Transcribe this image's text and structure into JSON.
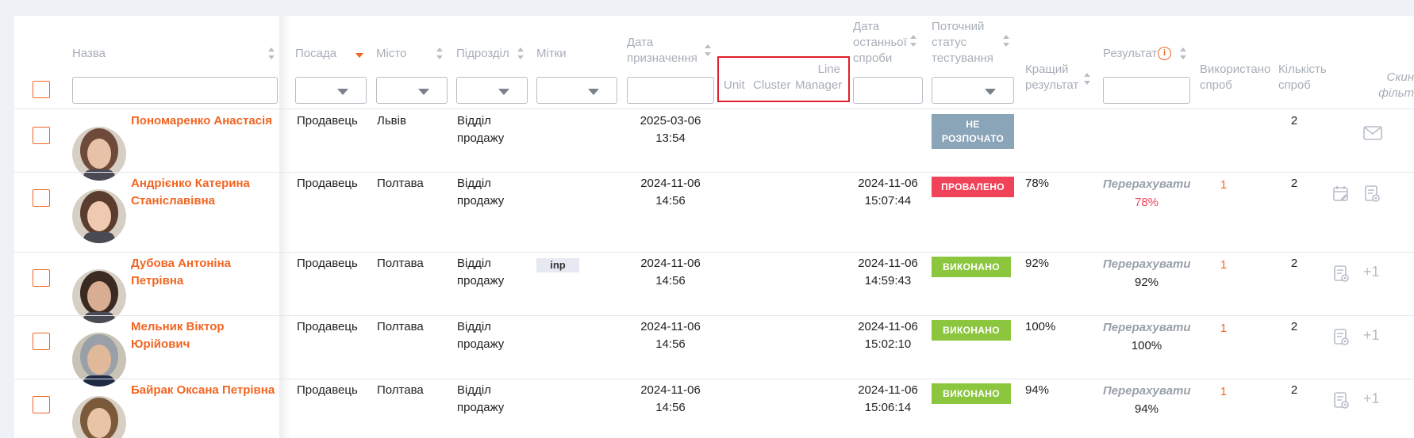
{
  "headers": {
    "name": "Назва",
    "position": "Посада",
    "city": "Місто",
    "department": "Підрозділ",
    "tags": "Мітки",
    "assigned_date_1": "Дата",
    "assigned_date_2": "призначення",
    "unit": "Unit",
    "cluster": "Cluster",
    "line_manager_1": "Line",
    "line_manager_2": "Manager",
    "last_try_1": "Дата",
    "last_try_2": "останньої",
    "last_try_3": "спроби",
    "status_1": "Поточний",
    "status_2": "статус",
    "status_3": "тестування",
    "best_1": "Кращий",
    "best_2": "результат",
    "result": "Результат",
    "used_1": "Використано",
    "used_2": "спроб",
    "count_1": "Кількість",
    "count_2": "спроб",
    "reset_1": "Скин",
    "reset_2": "фільт"
  },
  "rows": [
    {
      "name_1": "Пономаренко Анастасія",
      "name_2": "",
      "position": "Продавець",
      "city": "Львів",
      "dept_1": "Відділ",
      "dept_2": "продажу",
      "tag": "",
      "assigned_date": "2025-03-06",
      "assigned_time": "13:54",
      "last_date": "",
      "last_time": "",
      "status_1": "НЕ",
      "status_2": "РОЗПОЧАТО",
      "status_color": "#8aa4b8",
      "best": "",
      "recalc": "",
      "result": "",
      "used": "",
      "count": "2"
    },
    {
      "name_1": "Андрієнко Катерина",
      "name_2": "Станіславівна",
      "position": "Продавець",
      "city": "Полтава",
      "dept_1": "Відділ",
      "dept_2": "продажу",
      "tag": "",
      "assigned_date": "2024-11-06",
      "assigned_time": "14:56",
      "last_date": "2024-11-06",
      "last_time": "15:07:44",
      "status_1": "ПРОВАЛЕНО",
      "status_2": "",
      "status_color": "#f0435a",
      "best": "78%",
      "recalc": "Перерахувати",
      "result": "78%",
      "used": "1",
      "count": "2"
    },
    {
      "name_1": "Дубова Антоніна",
      "name_2": "Петрівна",
      "position": "Продавець",
      "city": "Полтава",
      "dept_1": "Відділ",
      "dept_2": "продажу",
      "tag": "inp",
      "assigned_date": "2024-11-06",
      "assigned_time": "14:56",
      "last_date": "2024-11-06",
      "last_time": "14:59:43",
      "status_1": "ВИКОНАНО",
      "status_2": "",
      "status_color": "#8cc63f",
      "best": "92%",
      "recalc": "Перерахувати",
      "result": "92%",
      "used": "1",
      "count": "2",
      "more": "+1"
    },
    {
      "name_1": "Мельник Віктор",
      "name_2": "Юрійович",
      "position": "Продавець",
      "city": "Полтава",
      "dept_1": "Відділ",
      "dept_2": "продажу",
      "tag": "",
      "assigned_date": "2024-11-06",
      "assigned_time": "14:56",
      "last_date": "2024-11-06",
      "last_time": "15:02:10",
      "status_1": "ВИКОНАНО",
      "status_2": "",
      "status_color": "#8cc63f",
      "best": "100%",
      "recalc": "Перерахувати",
      "result": "100%",
      "used": "1",
      "count": "2",
      "more": "+1"
    },
    {
      "name_1": "Байрак Оксана Петрівна",
      "name_2": "",
      "position": "Продавець",
      "city": "Полтава",
      "dept_1": "Відділ",
      "dept_2": "продажу",
      "tag": "",
      "assigned_date": "2024-11-06",
      "assigned_time": "14:56",
      "last_date": "2024-11-06",
      "last_time": "15:06:14",
      "status_1": "ВИКОНАНО",
      "status_2": "",
      "status_color": "#8cc63f",
      "best": "94%",
      "recalc": "Перерахувати",
      "result": "94%",
      "used": "1",
      "count": "2",
      "more": "+1"
    }
  ],
  "colors": {
    "accent": "#f26522",
    "failed": "#f0435a",
    "done": "#8cc63f",
    "not_started": "#8aa4b8",
    "highlight": "#e0202a"
  }
}
